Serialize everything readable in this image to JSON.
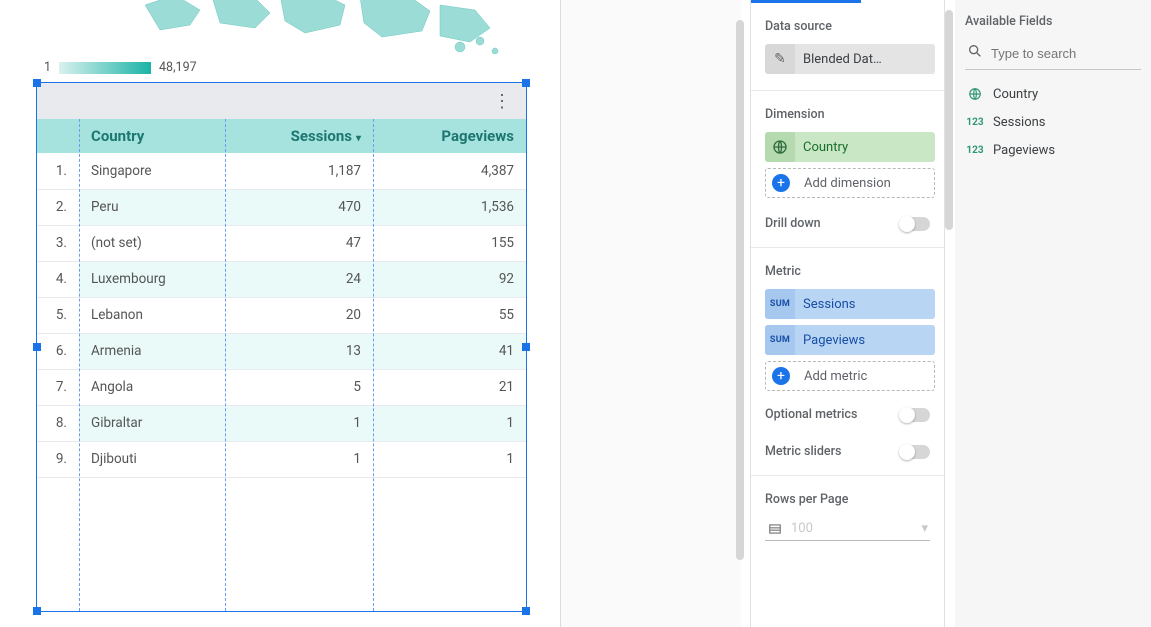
{
  "legend": {
    "min": "1",
    "max": "48,197"
  },
  "table": {
    "headers": {
      "col1": "Country",
      "col2": "Sessions",
      "col3": "Pageviews"
    },
    "sorted_col": "col2",
    "rows": [
      {
        "idx": "1.",
        "country": "Singapore",
        "sessions": "1,187",
        "pageviews": "4,387"
      },
      {
        "idx": "2.",
        "country": "Peru",
        "sessions": "470",
        "pageviews": "1,536"
      },
      {
        "idx": "3.",
        "country": "(not set)",
        "sessions": "47",
        "pageviews": "155"
      },
      {
        "idx": "4.",
        "country": "Luxembourg",
        "sessions": "24",
        "pageviews": "92"
      },
      {
        "idx": "5.",
        "country": "Lebanon",
        "sessions": "20",
        "pageviews": "55"
      },
      {
        "idx": "6.",
        "country": "Armenia",
        "sessions": "13",
        "pageviews": "41"
      },
      {
        "idx": "7.",
        "country": "Angola",
        "sessions": "5",
        "pageviews": "21"
      },
      {
        "idx": "8.",
        "country": "Gibraltar",
        "sessions": "1",
        "pageviews": "1"
      },
      {
        "idx": "9.",
        "country": "Djibouti",
        "sessions": "1",
        "pageviews": "1"
      }
    ]
  },
  "config": {
    "data_source_label": "Data source",
    "data_source_value": "Blended Dat…",
    "dimension_label": "Dimension",
    "dimension_value": "Country",
    "add_dimension": "Add dimension",
    "drill_down": "Drill down",
    "metric_label": "Metric",
    "metric1": "Sessions",
    "metric2": "Pageviews",
    "sum_badge": "SUM",
    "add_metric": "Add metric",
    "optional_metrics": "Optional metrics",
    "metric_sliders": "Metric sliders",
    "rows_per_page": "Rows per Page",
    "rows_value": "100"
  },
  "fields": {
    "title": "Available Fields",
    "search_placeholder": "Type to search",
    "items": [
      {
        "type": "geo",
        "label": "Country"
      },
      {
        "type": "num",
        "label": "Sessions"
      },
      {
        "type": "num",
        "label": "Pageviews"
      }
    ]
  }
}
